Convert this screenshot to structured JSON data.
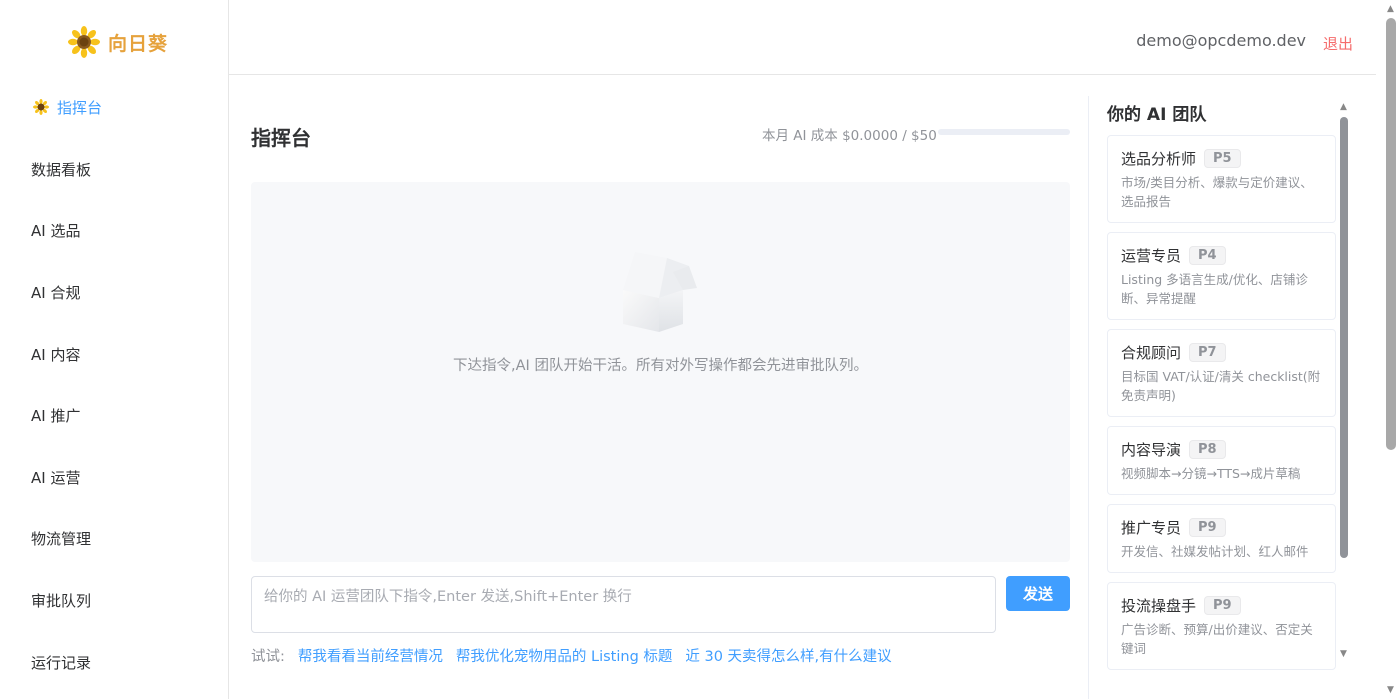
{
  "brand": {
    "name": "向日葵"
  },
  "nav": {
    "items": [
      {
        "label": "指挥台",
        "active": true
      },
      {
        "label": "数据看板"
      },
      {
        "label": "AI 选品"
      },
      {
        "label": "AI 合规"
      },
      {
        "label": "AI 内容"
      },
      {
        "label": "AI 推广"
      },
      {
        "label": "AI 运营"
      },
      {
        "label": "物流管理"
      },
      {
        "label": "审批队列"
      },
      {
        "label": "运行记录"
      }
    ]
  },
  "header": {
    "email": "demo@opcdemo.dev",
    "logout": "退出"
  },
  "main": {
    "title": "指挥台",
    "cost_text": "本月 AI 成本 $0.0000 / $50",
    "cost_progress": 0,
    "empty_text": "下达指令,AI 团队开始干活。所有对外写操作都会先进审批队列。",
    "input_placeholder": "给你的 AI 运营团队下指令,Enter 发送,Shift+Enter 换行",
    "send_label": "发送",
    "try_label": "试试:",
    "suggestions": [
      "帮我看看当前经营情况",
      "帮我优化宠物用品的 Listing 标题",
      "近 30 天卖得怎么样,有什么建议"
    ]
  },
  "team": {
    "title": "你的 AI 团队",
    "members": [
      {
        "name": "选品分析师",
        "tag": "P5",
        "desc": "市场/类目分析、爆款与定价建议、选品报告"
      },
      {
        "name": "运营专员",
        "tag": "P4",
        "desc": "Listing 多语言生成/优化、店铺诊断、异常提醒"
      },
      {
        "name": "合规顾问",
        "tag": "P7",
        "desc": "目标国 VAT/认证/清关 checklist(附免责声明)"
      },
      {
        "name": "内容导演",
        "tag": "P8",
        "desc": "视频脚本→分镜→TTS→成片草稿"
      },
      {
        "name": "推广专员",
        "tag": "P9",
        "desc": "开发信、社媒发帖计划、红人邮件"
      },
      {
        "name": "投流操盘手",
        "tag": "P9",
        "desc": "广告诊断、预算/出价建议、否定关键词"
      }
    ]
  },
  "colors": {
    "accent": "#409eff",
    "brand": "#e6a23c",
    "danger": "#f56c6c"
  },
  "icons": {
    "logo": "sunflower-icon",
    "nav_active": "sunflower-icon",
    "empty": "empty-box-icon"
  }
}
